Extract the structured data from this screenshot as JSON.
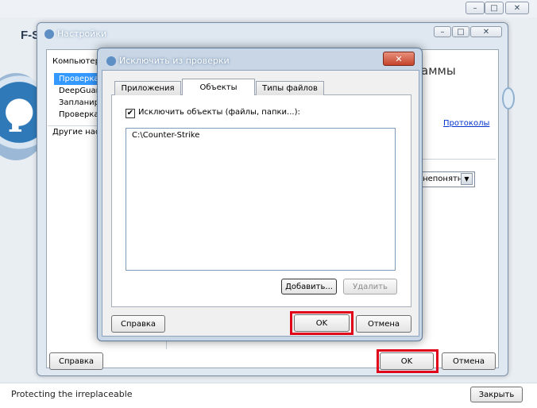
{
  "outer_window": {
    "brand_partial": "F-S",
    "footer_text": "Protecting the irreplaceable",
    "close_button": "Закрыть",
    "controls": {
      "minimize": "–",
      "maximize": "□",
      "close": "✕"
    }
  },
  "settings_window": {
    "title": "Настройки",
    "controls": {
      "minimize": "–",
      "maximize": "□",
      "close": "✕"
    },
    "nav": {
      "computer": "Компьютер",
      "items": [
        "Проверка н",
        "DeepGuard",
        "Запланиро",
        "Проверка е"
      ],
      "other": "Другие настр"
    },
    "right_heading_partial": "аммы",
    "link_protocols": "Протоколы",
    "dropdown_value": "в непонятн",
    "buttons": {
      "help": "Справка",
      "ok": "OK",
      "cancel": "Отмена"
    }
  },
  "exclude_dialog": {
    "title": "Исключить из проверки",
    "close_glyph": "✕",
    "tabs": [
      "Приложения",
      "Объекты",
      "Типы файлов"
    ],
    "active_tab": "Объекты",
    "checkbox": {
      "label": "Исключить объекты (файлы, папки...):",
      "checked": true,
      "mark": "✔"
    },
    "list_items": [
      "C:\\Counter-Strike"
    ],
    "buttons": {
      "add": "Добавить...",
      "delete": "Удалить",
      "help": "Справка",
      "ok": "OK",
      "cancel": "Отмена"
    }
  },
  "highlight_color": "#e0001a"
}
